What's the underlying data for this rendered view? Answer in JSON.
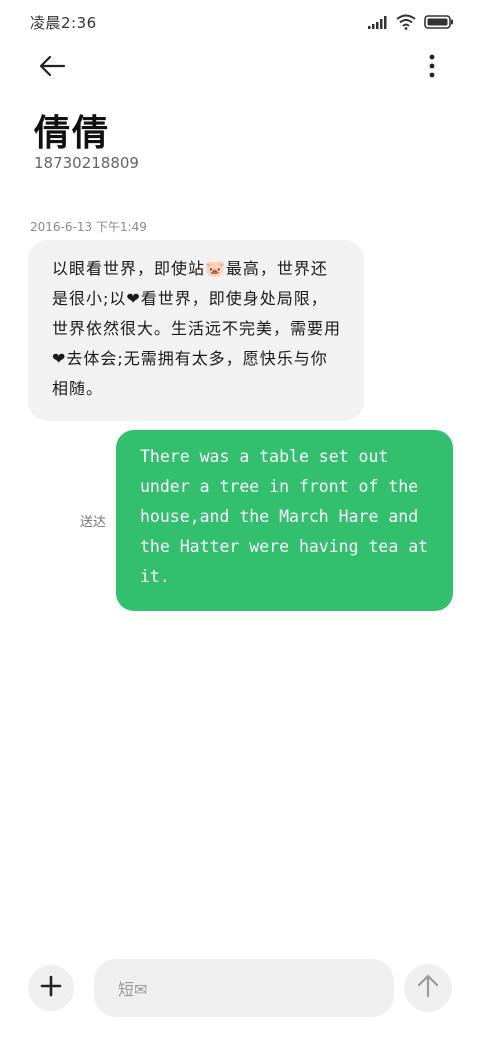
{
  "status_bar": {
    "time": "凌晨2:36",
    "icons": [
      "signal-icon",
      "wifi-icon",
      "battery-icon"
    ]
  },
  "header": {
    "back_icon": "arrow-left-icon",
    "more_icon": "more-vertical-icon",
    "contact_name": "倩倩",
    "contact_number": "18730218809"
  },
  "conversation": {
    "timestamp": "2016-6-13 下午1:49",
    "messages": [
      {
        "direction": "incoming",
        "text": "以眼看世界，即使站🐷最高，世界还是很小;以❤看世界，即使身处局限，世界依然很大。生活远不完美，需要用❤去体会;无需拥有太多，愿快乐与你相随。"
      },
      {
        "direction": "outgoing",
        "status": "送达",
        "text": "There was a table set out under a tree in front of the house,and the March Hare and the Hatter were having tea at it."
      }
    ]
  },
  "composer": {
    "add_icon": "plus-icon",
    "placeholder": "短✉",
    "send_icon": "arrow-up-icon"
  },
  "colors": {
    "outgoing_bubble": "#32c06e",
    "incoming_bubble": "#f2f2f2",
    "background": "#ffffff"
  }
}
